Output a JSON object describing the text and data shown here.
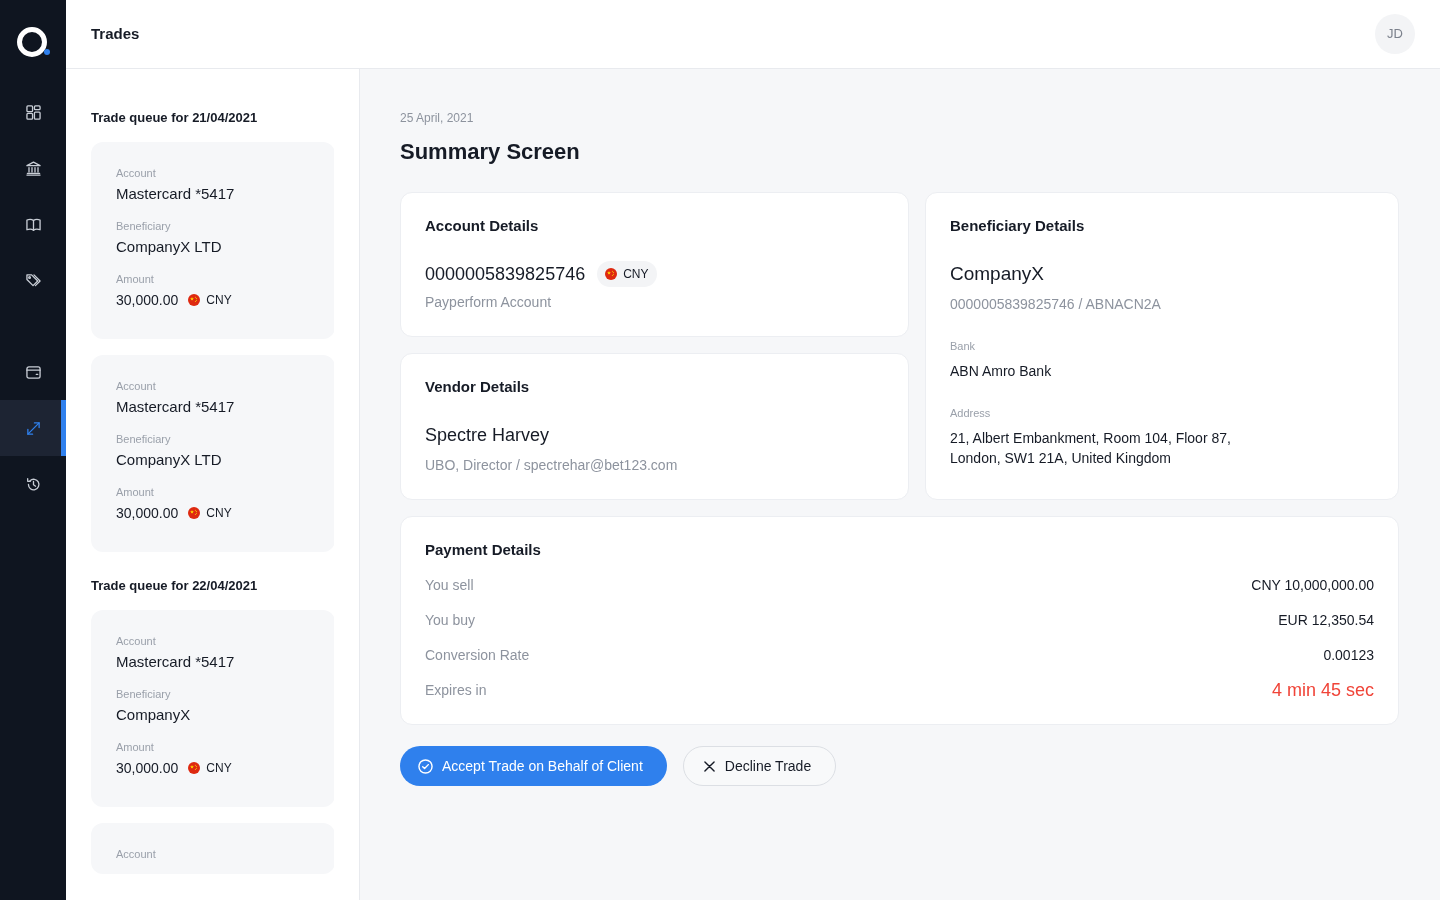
{
  "sidebar": {
    "groups": [
      {
        "items": [
          {
            "selected": false
          },
          {
            "selected": false
          },
          {
            "selected": false
          },
          {
            "selected": false
          }
        ]
      },
      {
        "items": [
          {
            "selected": false
          },
          {
            "selected": true
          },
          {
            "selected": false
          }
        ]
      }
    ]
  },
  "header": {
    "title": "Trades",
    "avatar": "JD"
  },
  "trade_queues": [
    {
      "title": "Trade queue for 21/04/2021",
      "trades": [
        {
          "fields": [
            {
              "label": "Account",
              "value": "Mastercard *5417"
            },
            {
              "label": "Beneficiary",
              "value": "CompanyX LTD"
            },
            {
              "label": "Amount",
              "value": "30,000.00",
              "currency": "CNY"
            }
          ]
        },
        {
          "fields": [
            {
              "label": "Account",
              "value": "Mastercard *5417"
            },
            {
              "label": "Beneficiary",
              "value": "CompanyX LTD"
            },
            {
              "label": "Amount",
              "value": "30,000.00",
              "currency": "CNY"
            }
          ]
        }
      ]
    },
    {
      "title": "Trade queue for 22/04/2021",
      "trades": [
        {
          "fields": [
            {
              "label": "Account",
              "value": "Mastercard *5417"
            },
            {
              "label": "Beneficiary",
              "value": "CompanyX"
            },
            {
              "label": "Amount",
              "value": "30,000.00",
              "currency": "CNY"
            }
          ]
        },
        {
          "fields": [
            {
              "label": "Account"
            }
          ]
        }
      ]
    }
  ],
  "summary": {
    "date": "25 April, 2021",
    "title": "Summary Screen",
    "account_details": {
      "title": "Account Details",
      "number": "0000005839825746",
      "currency": "CNY",
      "account_name": "Payperform Account"
    },
    "beneficiary_details": {
      "title": "Beneficiary Details",
      "name": "CompanyX",
      "subtitle": "0000005839825746 / ABNACN2A",
      "fields": [
        {
          "label": "Bank",
          "value": "ABN Amro Bank"
        },
        {
          "label": "Address",
          "value": "21, Albert Embankment, Room 104, Floor 87, London, SW1 21A, United Kingdom"
        }
      ]
    },
    "vendor_details": {
      "title": "Vendor Details",
      "name": "Spectre Harvey",
      "subtitle": "UBO, Director / spectrehar@bet123.com"
    },
    "payment_details": {
      "title": "Payment Details",
      "rows": [
        {
          "label": "You sell",
          "value": "CNY 10,000,000.00",
          "kind": "plain"
        },
        {
          "label": "You buy",
          "value": "EUR 12,350.54",
          "kind": "plain"
        },
        {
          "label": "Conversion Rate",
          "value": "0.00123",
          "kind": "plain"
        },
        {
          "label": "Expires in",
          "value": "4 min 45 sec",
          "kind": "countdown"
        }
      ]
    },
    "actions": [
      {
        "label": "Accept Trade on Behalf of Client",
        "kind": "primary"
      },
      {
        "label": "Decline Trade",
        "kind": "secondary"
      }
    ]
  }
}
